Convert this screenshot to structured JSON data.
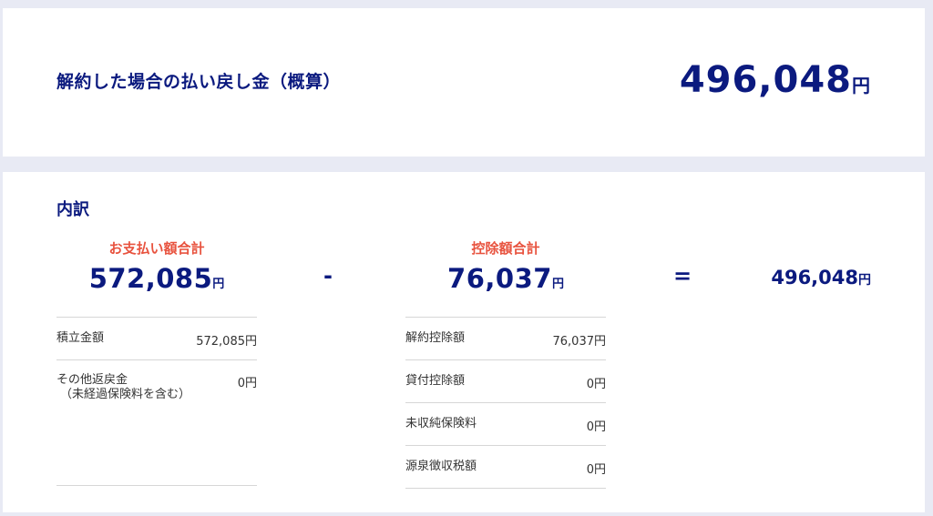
{
  "summary": {
    "title": "解約した場合の払い戻し金（概算）",
    "amount": "496,048",
    "unit": "円"
  },
  "breakdown": {
    "title": "内訳",
    "payments": {
      "heading": "お支払い額合計",
      "amount": "572,085",
      "unit": "円",
      "items": [
        {
          "label": "積立金額",
          "value": "572,085円"
        },
        {
          "label": "その他返戻金",
          "sublabel": "（未経過保険料を含む）",
          "value": "0円"
        }
      ]
    },
    "minus": "-",
    "deductions": {
      "heading": "控除額合計",
      "amount": "76,037",
      "unit": "円",
      "items": [
        {
          "label": "解約控除額",
          "value": "76,037円"
        },
        {
          "label": "貸付控除額",
          "value": "0円"
        },
        {
          "label": "未収純保険料",
          "value": "0円"
        },
        {
          "label": "源泉徴収税額",
          "value": "0円"
        }
      ]
    },
    "equals": "=",
    "result": {
      "amount": "496,048",
      "unit": "円"
    }
  },
  "colors": {
    "navy": "#0b1a7f",
    "accent": "#e8533f",
    "background": "#e8eaf4"
  }
}
